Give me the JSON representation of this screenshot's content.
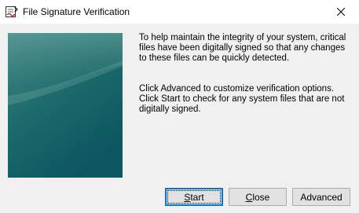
{
  "window": {
    "title": "File Signature Verification",
    "app_icon": "signature-verification-icon",
    "close_icon": "close-icon"
  },
  "description": {
    "paragraph1": "To help maintain the integrity of your system, critical files have been digitally signed so that any changes to these files can be quickly detected.",
    "paragraph2": "Click Advanced to customize verification options. Click Start to check for any system files that are not digitally signed."
  },
  "buttons": {
    "start": {
      "mnemonic": "S",
      "rest": "tart"
    },
    "close": {
      "mnemonic": "C",
      "rest": "lose"
    },
    "advanced": {
      "label": "Advanced"
    }
  },
  "colors": {
    "banner_top": "#4a8b8a",
    "banner_bottom": "#0e5a62",
    "focus_border": "#0078d7"
  }
}
